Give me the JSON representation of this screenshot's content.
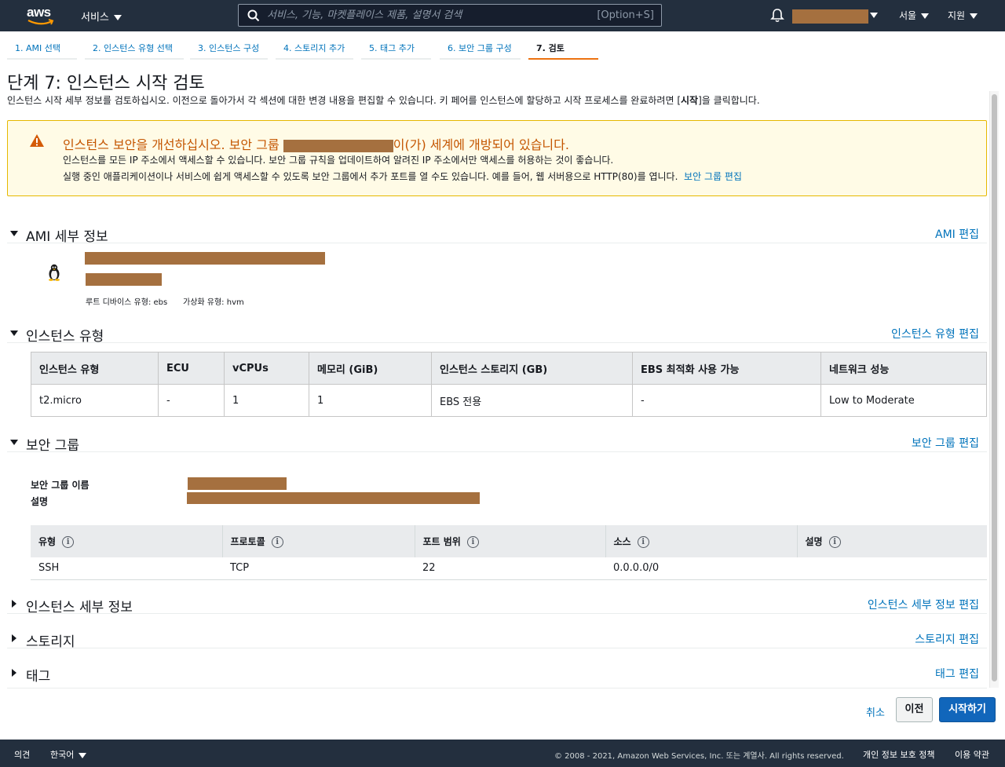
{
  "topnav": {
    "logo_text": "aws",
    "services_label": "서비스",
    "search_placeholder": "서비스, 기능, 마켓플레이스 제품, 설명서 검색",
    "search_shortcut": "[Option+S]",
    "region_label": "서울",
    "support_label": "지원"
  },
  "steps": [
    {
      "label": "1. AMI 선택"
    },
    {
      "label": "2. 인스턴스 유형 선택"
    },
    {
      "label": "3. 인스턴스 구성"
    },
    {
      "label": "4. 스토리지 추가"
    },
    {
      "label": "5. 태그 추가"
    },
    {
      "label": "6. 보안 그룹 구성"
    },
    {
      "label": "7. 검토"
    }
  ],
  "page": {
    "title": "단계 7: 인스턴스 시작 검토",
    "desc_before": "인스턴스 시작 세부 정보를 검토하십시오. 이전으로 돌아가서 각 섹션에 대한 변경 내용을 편집할 수 있습니다. 키 페어를 인스턴스에 할당하고 시작 프로세스를 완료하려면 [",
    "desc_bold": "시작",
    "desc_after": "]을 클릭합니다."
  },
  "warning": {
    "title_before": "인스턴스 보안을 개선하십시오. 보안 그룹",
    "title_after": "이(가) 세계에 개방되어 있습니다.",
    "line1": "인스턴스를 모든 IP 주소에서 액세스할 수 있습니다. 보안 그룹 규칙을 업데이트하여 알려진 IP 주소에서만 액세스를 허용하는 것이 좋습니다.",
    "line2": "실행 중인 애플리케이션이나 서비스에 쉽게 액세스할 수 있도록 보안 그룹에서 추가 포트를 열 수도 있습니다. 예를 들어, 웹 서버용으로 HTTP(80)를 엽니다.",
    "link": "보안 그룹 편집"
  },
  "ami": {
    "title": "AMI 세부 정보",
    "edit": "AMI 편집",
    "root_device": "루트 디바이스 유형: ebs",
    "virtualization": "가상화 유형: hvm"
  },
  "instance_type": {
    "title": "인스턴스 유형",
    "edit": "인스턴스 유형 편집",
    "headers": [
      "인스턴스 유형",
      "ECU",
      "vCPUs",
      "메모리 (GiB)",
      "인스턴스 스토리지 (GB)",
      "EBS 최적화 사용 가능",
      "네트워크 성능"
    ],
    "row": [
      "t2.micro",
      "-",
      "1",
      "1",
      "EBS 전용",
      "-",
      "Low to Moderate"
    ]
  },
  "security_group": {
    "title": "보안 그룹",
    "edit": "보안 그룹 편집",
    "name_label": "보안 그룹 이름",
    "desc_label": "설명",
    "headers": [
      "유형",
      "프로토콜",
      "포트 범위",
      "소스",
      "설명"
    ],
    "row": [
      "SSH",
      "TCP",
      "22",
      "0.0.0.0/0",
      ""
    ]
  },
  "instance_details": {
    "title": "인스턴스 세부 정보",
    "edit": "인스턴스 세부 정보 편집"
  },
  "storage": {
    "title": "스토리지",
    "edit": "스토리지 편집"
  },
  "tags": {
    "title": "태그",
    "edit": "태그 편집"
  },
  "buttons": {
    "cancel": "취소",
    "previous": "이전",
    "launch": "시작하기"
  },
  "footer": {
    "feedback": "의견",
    "language": "한국어",
    "copyright": "© 2008 - 2021, Amazon Web Services, Inc. 또는 계열사. All rights reserved.",
    "privacy": "개인 정보 보호 정책",
    "terms": "이용 약관"
  },
  "colors": {
    "nav_bg": "#232f3e",
    "link": "#0073bb",
    "active_step": "#ec7211",
    "warning_title": "#c45500",
    "primary_button": "#1166bb",
    "redaction": "#a5703f"
  }
}
